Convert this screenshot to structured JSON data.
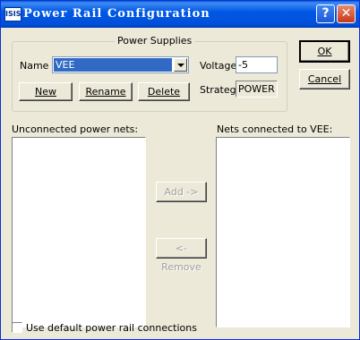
{
  "window": {
    "title": "Power Rail Configuration",
    "icon_text": "ISIS",
    "help_glyph": "?",
    "close_glyph": "✕"
  },
  "power_supplies": {
    "group_label": "Power Supplies",
    "name_label": "Name",
    "name_value": "VEE",
    "voltage_label": "Voltage",
    "voltage_value": "-5",
    "strategy_label": "Strateg:",
    "strategy_value": "POWER",
    "new_button": "New",
    "rename_button": "Rename",
    "delete_button": "Delete"
  },
  "dialog_buttons": {
    "ok": "OK",
    "cancel": "Cancel"
  },
  "lists": {
    "unconnected_label": "Unconnected power nets:",
    "unconnected_items": [],
    "connected_label": "Nets connected to VEE:",
    "connected_items": []
  },
  "transfer_buttons": {
    "add": "Add ->",
    "remove": "<- Remove",
    "enabled": false
  },
  "default_connections": {
    "label": "Use default power rail connections",
    "checked": false
  }
}
